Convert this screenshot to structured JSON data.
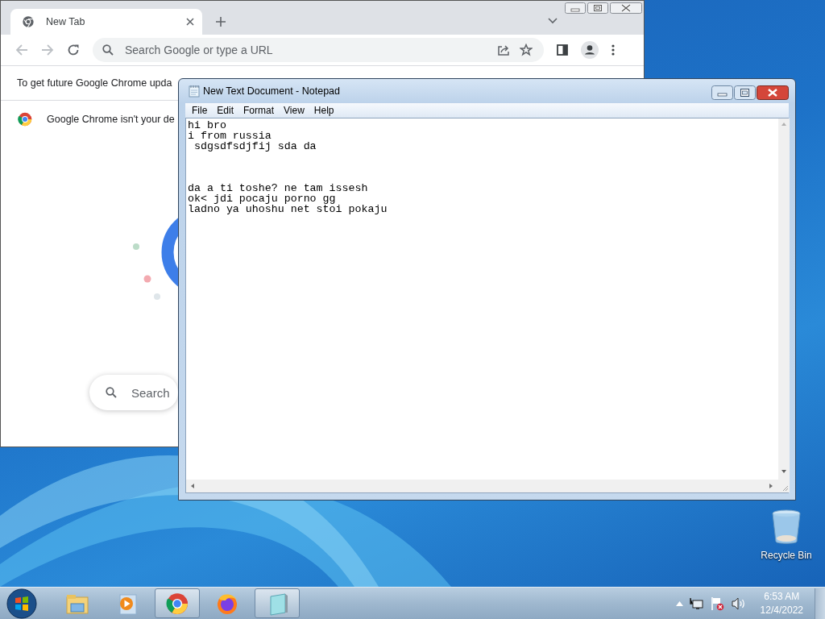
{
  "chrome_window": {
    "tab": {
      "title": "New Tab",
      "selected": true
    },
    "address_bar": {
      "placeholder": "Search Google or type a URL"
    },
    "infobars": [
      "To get future Google Chrome upda",
      "Google Chrome isn't your de"
    ],
    "search_box": {
      "placeholder": "Search"
    }
  },
  "notepad": {
    "title": "New Text Document - Notepad",
    "menu": [
      "File",
      "Edit",
      "Format",
      "View",
      "Help"
    ],
    "text": "hi bro\ni from russia\n sdgsdfsdjfij sda da\n\n\n\nda a ti toshe? ne tam issesh\nok< jdi pocaju porno gg\nladno ya uhoshu net stoi pokaju"
  },
  "desktop_icons": [
    {
      "label": "Recycle Bin"
    }
  ],
  "taskbar": {
    "apps": [
      {
        "kind": "explorer",
        "active": false
      },
      {
        "kind": "media",
        "active": false
      },
      {
        "kind": "chrome",
        "active": true
      },
      {
        "kind": "firefox",
        "active": false
      },
      {
        "kind": "notepad",
        "active": true
      }
    ],
    "clock": {
      "time": "6:53 AM",
      "date": "12/4/2022"
    }
  }
}
